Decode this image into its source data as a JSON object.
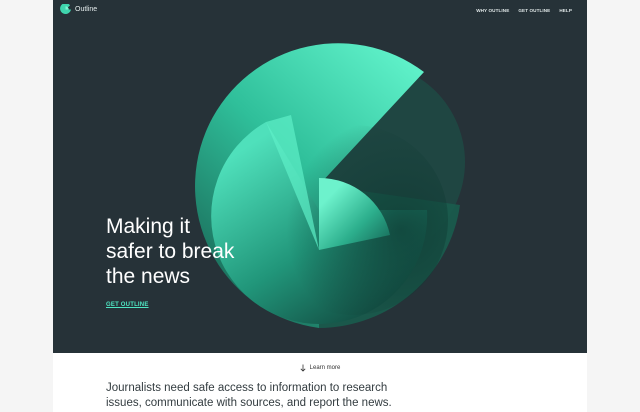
{
  "brand": {
    "name": "Outline",
    "accent": "#4ee6c3",
    "hero_bg": "#263238"
  },
  "nav": {
    "items": [
      {
        "label": "WHY OUTLINE"
      },
      {
        "label": "GET OUTLINE"
      },
      {
        "label": "HELP"
      }
    ]
  },
  "hero": {
    "headline_lines": [
      "Making it",
      "safer to break",
      "the news"
    ],
    "cta_label": "GET OUTLINE"
  },
  "learn_more": {
    "label": "Learn more",
    "icon": "arrow-down-icon"
  },
  "intro": {
    "lines": [
      "Journalists need safe access to information to research",
      "issues, communicate with sources, and report the news."
    ]
  }
}
